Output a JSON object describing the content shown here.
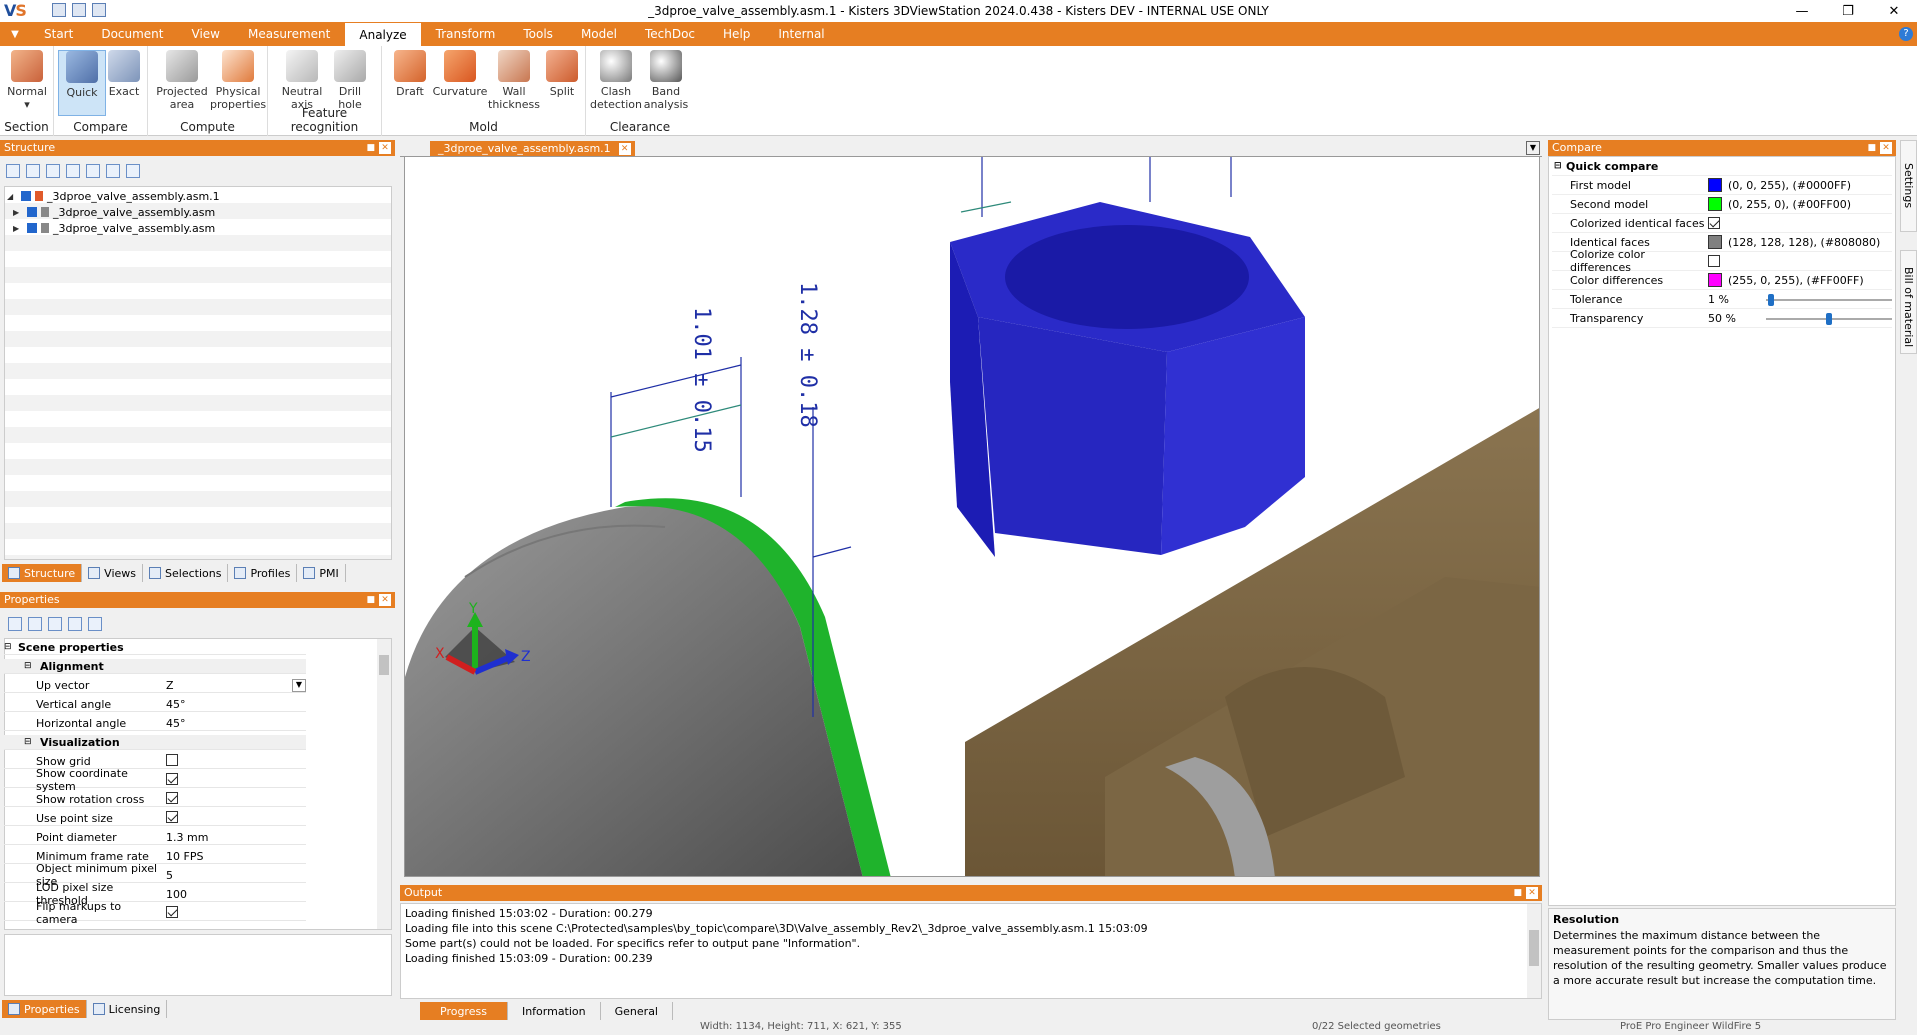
{
  "window": {
    "title": "_3dproe_valve_assembly.asm.1 - Kisters 3DViewStation 2024.0.438 - Kisters DEV - INTERNAL USE ONLY",
    "logo": "VS"
  },
  "menu": {
    "tabs": [
      "Start",
      "Document",
      "View",
      "Measurement",
      "Analyze",
      "Transform",
      "Tools",
      "Model",
      "TechDoc",
      "Help",
      "Internal"
    ],
    "active": "Analyze"
  },
  "ribbon": {
    "groups": [
      {
        "label": "Section",
        "buttons": [
          "Normal"
        ]
      },
      {
        "label": "Compare",
        "buttons": [
          "Quick",
          "Exact"
        ]
      },
      {
        "label": "Compute",
        "buttons": [
          "Projected area",
          "Physical properties"
        ]
      },
      {
        "label": "Feature recognition",
        "buttons": [
          "Neutral axis",
          "Drill hole"
        ]
      },
      {
        "label": "Mold",
        "buttons": [
          "Draft",
          "Curvature",
          "Wall thickness",
          "Split"
        ]
      },
      {
        "label": "Clearance",
        "buttons": [
          "Clash detection",
          "Band analysis"
        ]
      }
    ]
  },
  "structure": {
    "title": "Structure",
    "items": [
      "_3dproe_valve_assembly.asm.1",
      "_3dproe_valve_assembly.asm",
      "_3dproe_valve_assembly.asm"
    ],
    "tabs": [
      "Structure",
      "Views",
      "Selections",
      "Profiles",
      "PMI"
    ]
  },
  "properties": {
    "title": "Properties",
    "scene": "Scene properties",
    "alignment": "Alignment",
    "up_vector": {
      "label": "Up vector",
      "value": "Z"
    },
    "vertical_angle": {
      "label": "Vertical angle",
      "value": "45°"
    },
    "horizontal_angle": {
      "label": "Horizontal angle",
      "value": "45°"
    },
    "visualization": "Visualization",
    "show_grid": {
      "label": "Show grid",
      "checked": false
    },
    "show_coord": {
      "label": "Show coordinate system",
      "checked": true
    },
    "show_rotation": {
      "label": "Show rotation cross",
      "checked": true
    },
    "use_point_size": {
      "label": "Use point size",
      "checked": true
    },
    "point_diameter": {
      "label": "Point diameter",
      "value": "1.3 mm"
    },
    "min_frame_rate": {
      "label": "Minimum frame rate",
      "value": "10 FPS"
    },
    "obj_min_pixel": {
      "label": "Object minimum pixel size",
      "value": "5"
    },
    "lod_threshold": {
      "label": "LOD pixel size threshold",
      "value": "100"
    },
    "flip_markups": {
      "label": "Flip markups to camera",
      "checked": true
    },
    "tabs": [
      "Properties",
      "Licensing"
    ]
  },
  "viewer": {
    "doc_tab": "_3dproe_valve_assembly.asm.1",
    "dimension_1": "1.01 ± 0.15",
    "dimension_2": "1.28 ± 0.18"
  },
  "compare": {
    "title": "Compare",
    "section": "Quick compare",
    "first_model": {
      "label": "First model",
      "value": "(0, 0, 255), (#0000FF)",
      "color": "#0000FF"
    },
    "second_model": {
      "label": "Second model",
      "value": "(0, 255, 0), (#00FF00)",
      "color": "#00FF00"
    },
    "colorized_identical": {
      "label": "Colorized identical faces",
      "checked": true
    },
    "identical_faces": {
      "label": "Identical faces",
      "value": "(128, 128, 128), (#808080)",
      "color": "#808080"
    },
    "colorize_diff": {
      "label": "Colorize color differences",
      "checked": false
    },
    "color_diff": {
      "label": "Color differences",
      "value": "(255, 0, 255), (#FF00FF)",
      "color": "#FF00FF"
    },
    "tolerance": {
      "label": "Tolerance",
      "value": "1 %",
      "fraction": 0.02
    },
    "transparency": {
      "label": "Transparency",
      "value": "50 %",
      "fraction": 0.5
    },
    "side_tabs": [
      "Settings",
      "Bill of material"
    ]
  },
  "resolution_help": {
    "title": "Resolution",
    "text": "Determines the maximum distance between the measurement points for the comparison and thus the resolution of the resulting geometry. Smaller values produce a more accurate result but increase the computation time."
  },
  "output": {
    "title": "Output",
    "lines": [
      "Loading finished 15:03:02 - Duration: 00.279",
      "Loading file into this scene C:\\Protected\\samples\\by_topic\\compare\\3D\\Valve_assembly_Rev2\\_3dproe_valve_assembly.asm.1 15:03:09",
      "Some part(s) could not be loaded. For specifics refer to output pane \"Information\".",
      "Loading finished 15:03:09 - Duration: 00.239"
    ],
    "tabs": [
      "Progress",
      "Information",
      "General"
    ]
  },
  "status": {
    "dims": "Width: 1134, Height: 711, X: 621, Y: 355",
    "selected": "0/22 Selected geometries",
    "format": "ProE Pro Engineer WildFire 5"
  },
  "axes": {
    "x": "X",
    "y": "Y",
    "z": "Z"
  }
}
